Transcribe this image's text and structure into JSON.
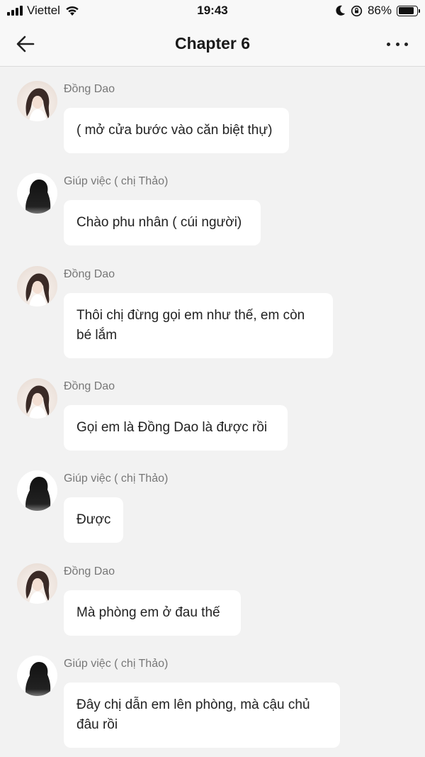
{
  "status_bar": {
    "carrier": "Viettel",
    "time": "19:43",
    "battery_percent": "86%",
    "battery_level": 0.86
  },
  "nav": {
    "title": "Chapter 6"
  },
  "messages": [
    {
      "sender": "Đồng Dao",
      "avatar": "girl-avatar",
      "text": "( mở cửa bước vào căn biệt thự)"
    },
    {
      "sender": "Giúp việc ( chị Thảo)",
      "avatar": "silhouette-avatar",
      "text": "Chào phu nhân ( cúi người)"
    },
    {
      "sender": "Đồng Dao",
      "avatar": "girl-avatar",
      "text": "Thôi chị đừng gọi em như thế, em còn bé lắm"
    },
    {
      "sender": "Đồng Dao",
      "avatar": "girl-avatar",
      "text": "Gọi em là Đồng Dao là được rồi"
    },
    {
      "sender": "Giúp việc ( chị Thảo)",
      "avatar": "silhouette-avatar",
      "text": "Được"
    },
    {
      "sender": "Đồng Dao",
      "avatar": "girl-avatar",
      "text": "Mà phòng em ở đau thế"
    },
    {
      "sender": "Giúp việc ( chị Thảo)",
      "avatar": "silhouette-avatar",
      "text": "Đây chị dẫn em lên phòng, mà cậu chủ đâu rồi"
    }
  ]
}
